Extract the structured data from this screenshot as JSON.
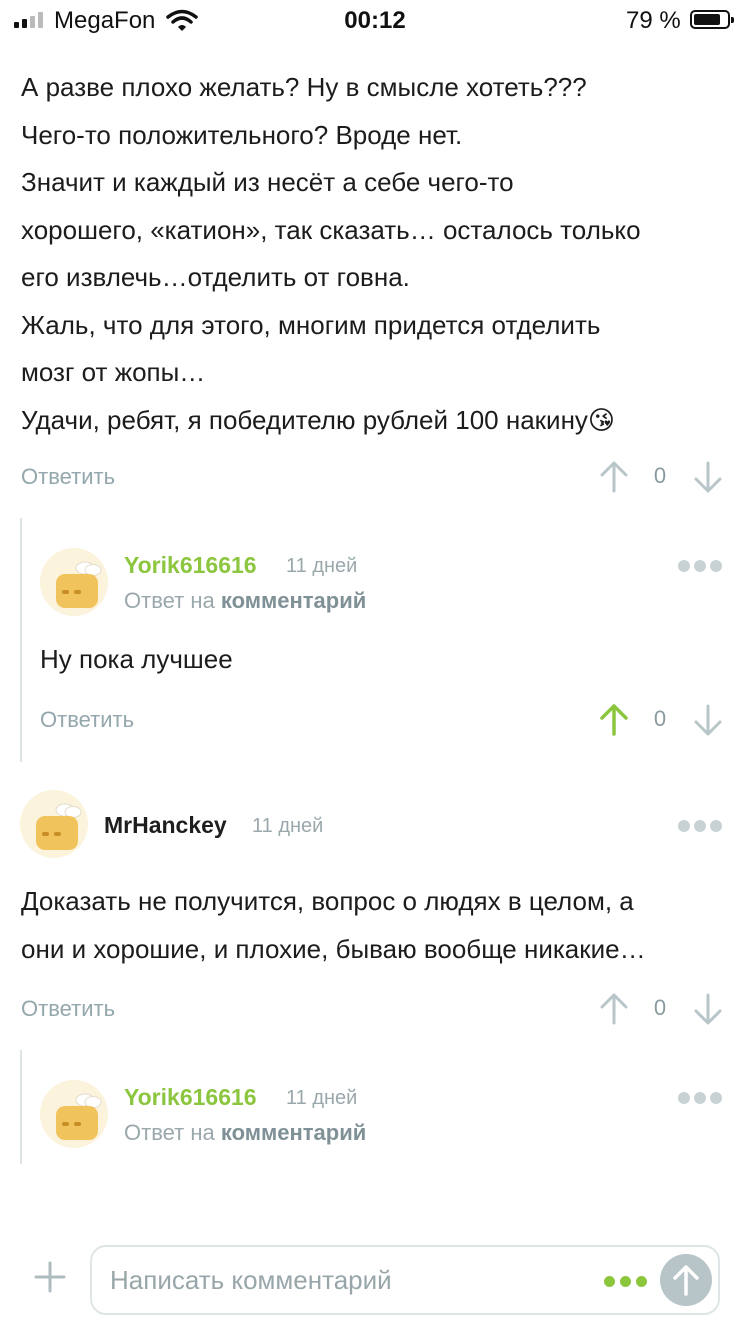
{
  "status": {
    "carrier": "MegaFon",
    "time": "00:12",
    "battery": "79 %"
  },
  "post": {
    "lines": [
      "А разве плохо желать? Ну в смысле хотеть???",
      "Чего-то положительного? Вроде нет.",
      "Значит и каждый из несёт а себе чего-то",
      "хорошего, «катион», так сказать… осталось только",
      "его извлечь…отделить от говна.",
      "Жаль, что для этого, многим придется отделить",
      "мозг от жопы…",
      "Удачи, ребят, я победителю рублей 100 накину😘"
    ],
    "reply_label": "Ответить",
    "votes": "0"
  },
  "comments": [
    {
      "author": "Yorik616616",
      "date": "11 дней",
      "reply_prefix": "Ответ на",
      "reply_link": "комментарий",
      "text": "Ну пока лучшее",
      "reply_label": "Ответить",
      "votes": "0",
      "upvoted": true
    },
    {
      "author": "MrHanckey",
      "date": "11 дней",
      "text_lines": [
        "Доказать не получится, вопрос о людях в целом, а",
        "они и хорошие, и плохие, бываю вообще никакие…"
      ],
      "reply_label": "Ответить",
      "votes": "0"
    },
    {
      "author": "Yorik616616",
      "date": "11 дней",
      "reply_prefix": "Ответ на",
      "reply_link": "комментарий"
    }
  ],
  "composer": {
    "placeholder": "Написать комментарий"
  },
  "colors": {
    "accent_green": "#8cc63f",
    "muted": "#93a7ad"
  }
}
